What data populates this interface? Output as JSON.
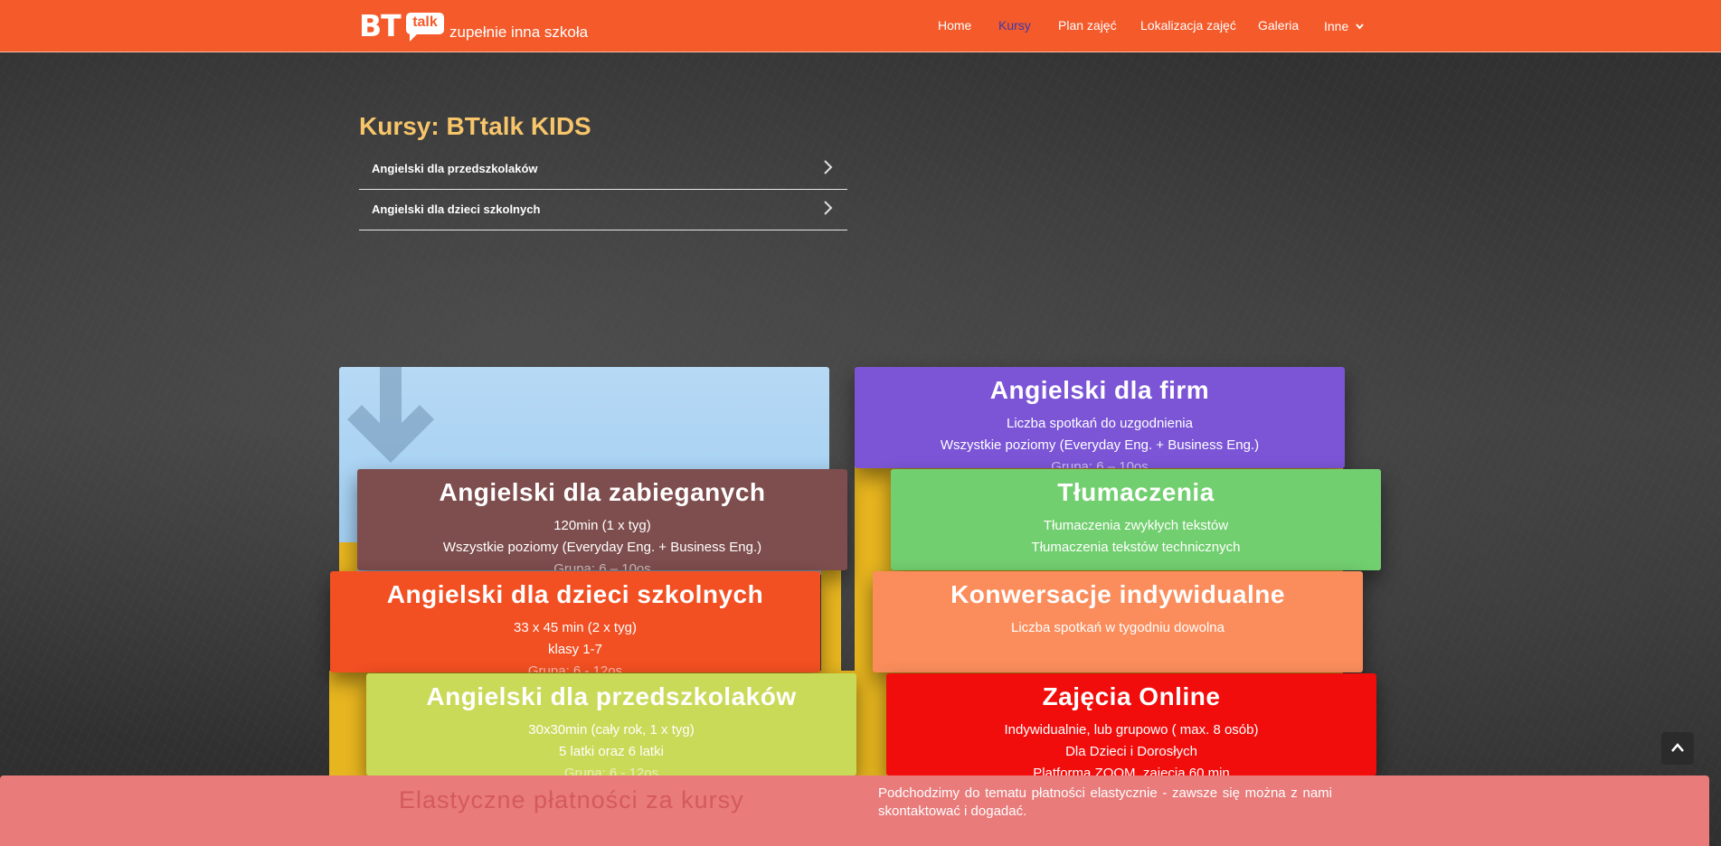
{
  "header": {
    "logo_bt": "BT",
    "logo_talk": "talk",
    "tagline": "zupełnie inna szkoła",
    "nav": [
      {
        "label": "Home"
      },
      {
        "label": "Kursy"
      },
      {
        "label": "Plan zajęć"
      },
      {
        "label": "Lokalizacja zajęć"
      },
      {
        "label": "Galeria"
      },
      {
        "label": "Inne"
      }
    ],
    "active_nav": "Kursy",
    "accent_color": "#f45a2a"
  },
  "courses_section": {
    "heading": "Kursy: BTtalk KIDS",
    "items": [
      {
        "label": "Angielski dla przedszkolaków"
      },
      {
        "label": "Angielski dla dzieci szkolnych"
      }
    ]
  },
  "cards": [
    {
      "title": "Angielski dla firm",
      "lines": [
        "Liczba spotkań do uzgodnienia",
        "Wszystkie poziomy (Everyday Eng. + Business Eng.)",
        "Grupa: 6 – 10os"
      ],
      "color": "#7b55d6"
    },
    {
      "title": "Angielski dla zabieganych",
      "lines": [
        "120min (1 x tyg)",
        "Wszystkie poziomy (Everyday Eng. + Business Eng.)",
        "Grupa: 6 – 10os"
      ],
      "color": "#7e4d4d"
    },
    {
      "title": "Tłumaczenia",
      "lines": [
        "Tłumaczenia zwykłych tekstów",
        "Tłumaczenia tekstów technicznych"
      ],
      "color": "#72cf6f"
    },
    {
      "title": "Angielski dla dzieci szkolnych",
      "lines": [
        "33 x 45 min (2 x tyg)",
        "klasy 1-7",
        "Grupa: 6 - 12os"
      ],
      "color": "#f24f22"
    },
    {
      "title": "Konwersacje indywidualne",
      "lines": [
        "Liczba spotkań w tygodniu dowolna"
      ],
      "color": "#fb8d5c"
    },
    {
      "title": "Angielski dla przedszkolaków",
      "lines": [
        "30x30min (cały rok, 1 x tyg)",
        "5 latki oraz 6 latki",
        "Grupa: 6 - 12os"
      ],
      "color": "#c9da58"
    },
    {
      "title": "Zajęcia Online",
      "lines": [
        "Indywidualnie, lub grupowo ( max. 8 osób)",
        "Dla Dzieci i Dorosłych",
        "Platforma ZOOM, zajęcia 60 min"
      ],
      "color": "#f20d0d"
    }
  ],
  "icons": {
    "nav_more": "chevron-down-icon",
    "menu_arrow": "chevron-right-icon",
    "scroll_top": "chevron-up-icon",
    "decor": "arrow-down-icon"
  },
  "banner": {
    "title": "Elastyczne płatności za kursy",
    "text": "Podchodzimy do tematu płatności elastycznie - zawsze się można z nami skontaktować i dogadać.",
    "color": "#e97b7b"
  }
}
